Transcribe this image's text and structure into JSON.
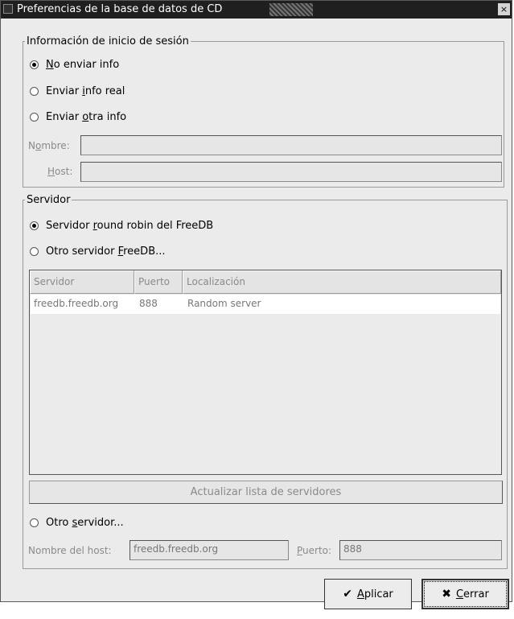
{
  "window": {
    "title": "Preferencias de la base de datos de CD",
    "close_glyph": "×"
  },
  "login": {
    "legend": "Información de inicio de sesión",
    "options": [
      {
        "pre": "",
        "key": "N",
        "post": "o enviar info",
        "selected": true
      },
      {
        "pre": "Enviar ",
        "key": "i",
        "post": "nfo real",
        "selected": false
      },
      {
        "pre": "Enviar ",
        "key": "o",
        "post": "tra info",
        "selected": false
      }
    ],
    "name_label": {
      "pre": "N",
      "key": "o",
      "post": "mbre:"
    },
    "name_value": "",
    "host_label": {
      "pre": "",
      "key": "H",
      "post": "ost:"
    },
    "host_value": ""
  },
  "server": {
    "legend": "Servidor",
    "opt_roundrobin": {
      "pre": "Servidor ",
      "key": "r",
      "post": "ound robin del FreeDB",
      "selected": true
    },
    "opt_other_freedb": {
      "pre": "Otro servidor ",
      "key": "F",
      "post": "reeDB...",
      "selected": false
    },
    "table": {
      "columns": [
        "Servidor",
        "Puerto",
        "Localización"
      ],
      "rows": [
        [
          "freedb.freedb.org",
          "888",
          "Random server"
        ]
      ]
    },
    "update_button": "Actualizar lista de servidores",
    "opt_other": {
      "pre": "Otro ",
      "key": "s",
      "post": "ervidor...",
      "selected": false
    },
    "hostname_label": "Nombre del host:",
    "hostname_value": "freedb.freedb.org",
    "port_label": {
      "pre": "",
      "key": "P",
      "post": "uerto:"
    },
    "port_value": "888"
  },
  "buttons": {
    "apply": {
      "pre": "",
      "key": "A",
      "post": "plicar",
      "icon": "✔"
    },
    "close": {
      "pre": "",
      "key": "C",
      "post": "errar",
      "icon": "✖"
    }
  }
}
